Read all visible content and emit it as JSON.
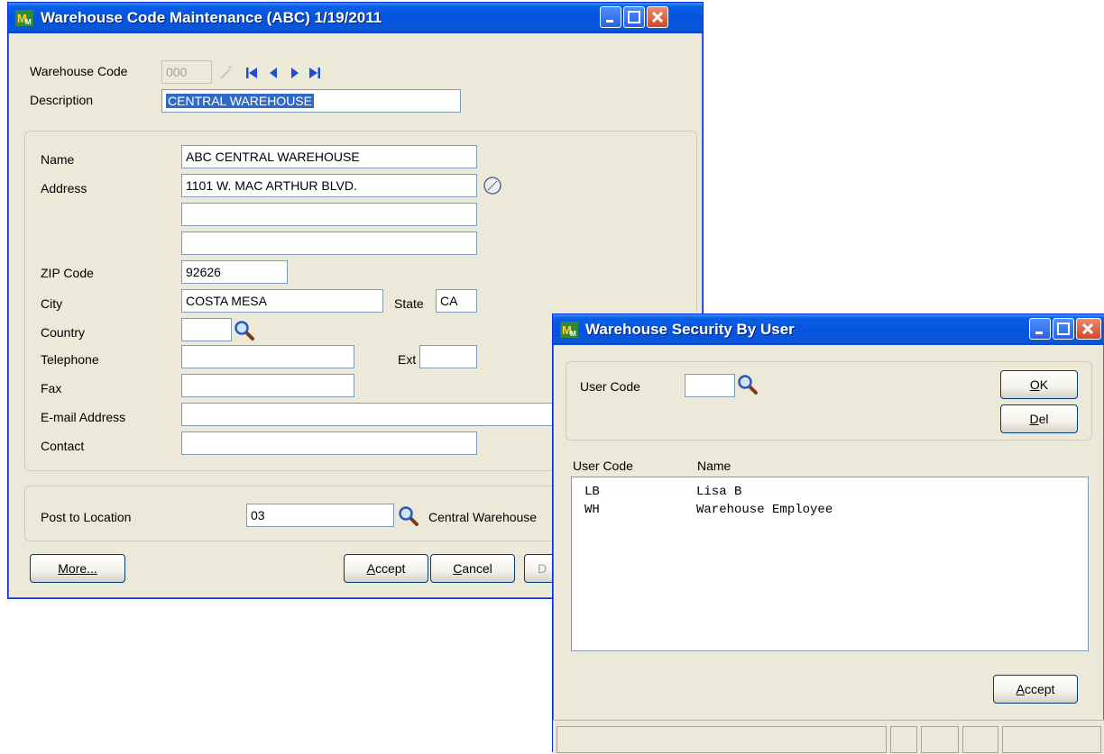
{
  "main_window": {
    "title": "Warehouse Code Maintenance (ABC) 1/19/2011",
    "warehouse_code_label": "Warehouse Code",
    "warehouse_code_value": "000",
    "description_label": "Description",
    "description_value": "CENTRAL WAREHOUSE",
    "name_label": "Name",
    "name_value": "ABC CENTRAL WAREHOUSE",
    "address_label": "Address",
    "address_line1": "1101 W. MAC ARTHUR BLVD.",
    "address_line2": "",
    "address_line3": "",
    "zip_label": "ZIP Code",
    "zip_value": "92626",
    "city_label": "City",
    "city_value": "COSTA MESA",
    "state_label": "State",
    "state_value": "CA",
    "country_label": "Country",
    "country_value": "",
    "telephone_label": "Telephone",
    "telephone_value": "",
    "ext_label": "Ext",
    "ext_value": "",
    "fax_label": "Fax",
    "fax_value": "",
    "email_label": "E-mail Address",
    "email_value": "",
    "contact_label": "Contact",
    "contact_value": "",
    "post_to_location_label": "Post to Location",
    "post_to_location_value": "03",
    "post_to_location_desc": "Central Warehouse",
    "more_button": "More...",
    "accept_button": "Accept",
    "cancel_button": "Cancel",
    "delete_button_partial": "D"
  },
  "security_window": {
    "title": "Warehouse Security By User",
    "user_code_label": "User Code",
    "user_code_value": "",
    "ok_button": "OK",
    "del_button": "Del",
    "columns": [
      "User Code",
      "Name"
    ],
    "rows": [
      {
        "code": "LB",
        "name": "Lisa B"
      },
      {
        "code": "WH",
        "name": "Warehouse Employee"
      }
    ],
    "accept_button": "Accept"
  },
  "icons": {
    "lookup": "magnifier-icon",
    "address_map": "compass-icon",
    "nav": [
      "first-record-icon",
      "previous-record-icon",
      "next-record-icon",
      "last-record-icon"
    ]
  },
  "colors": {
    "title_bar": "#0553e0",
    "window_bg": "#ece9d8",
    "selection": "#316ac5"
  }
}
